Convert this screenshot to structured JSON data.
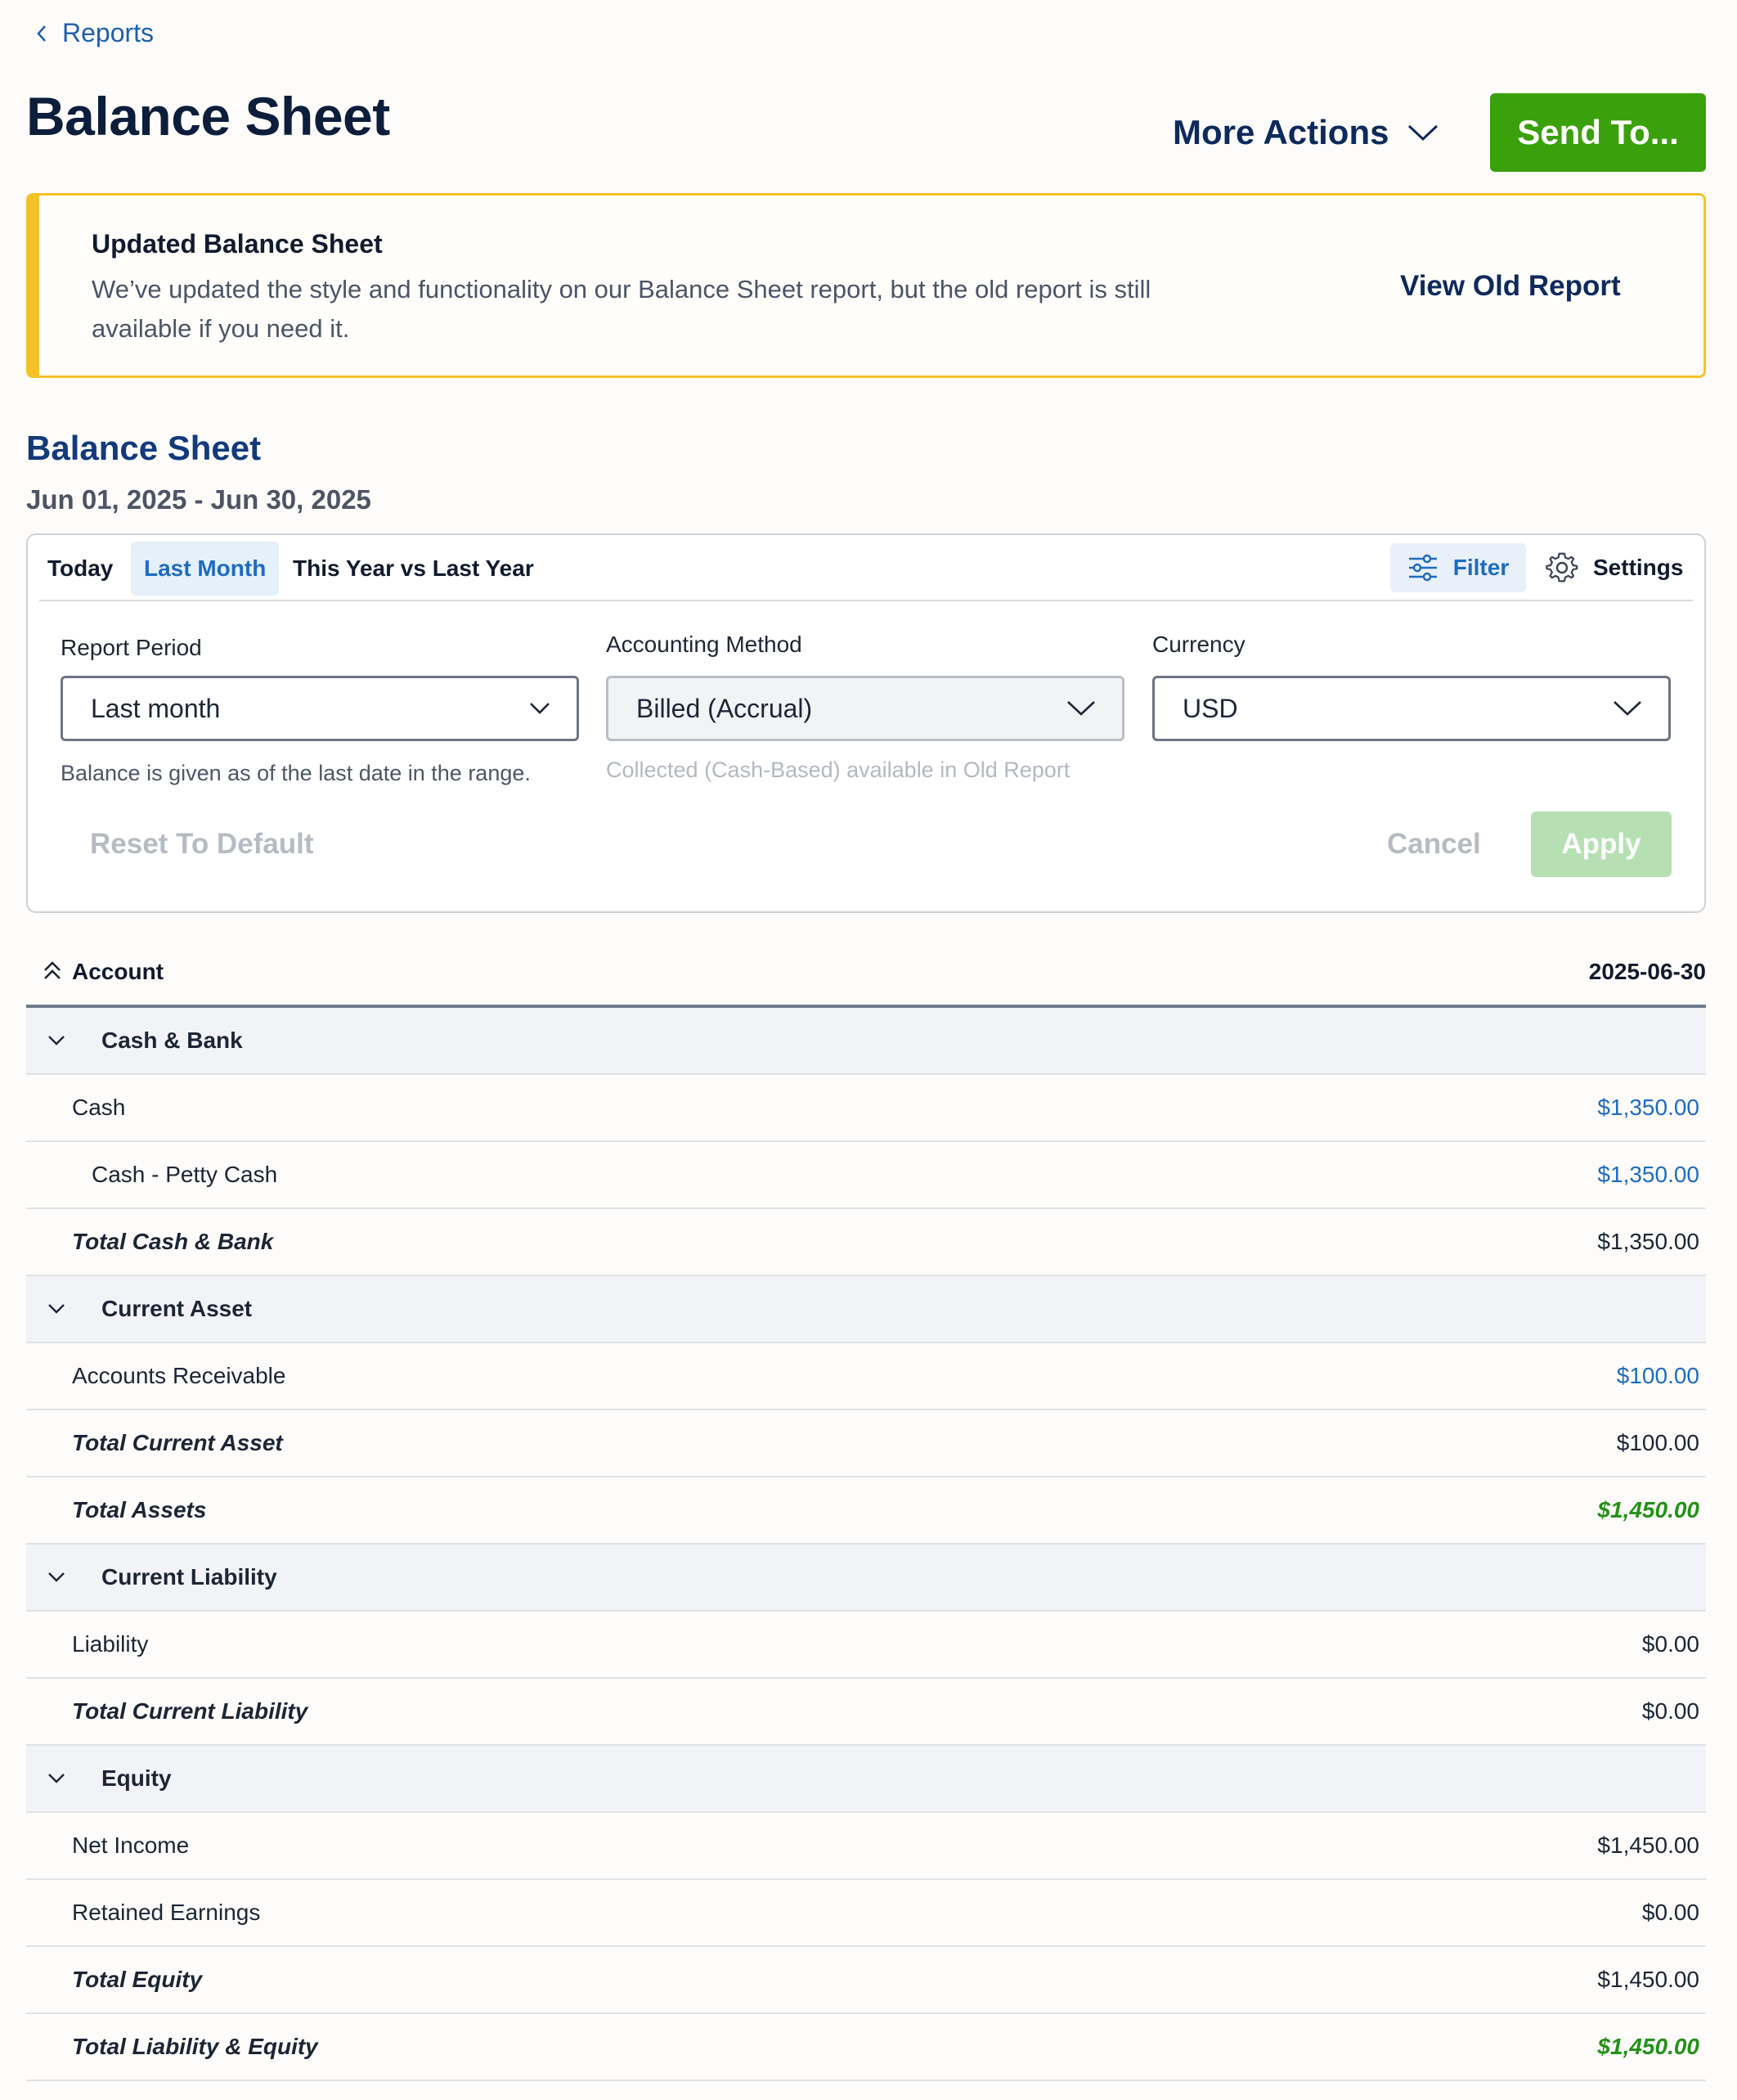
{
  "nav": {
    "back_label": "Reports"
  },
  "header": {
    "title": "Balance Sheet",
    "more_actions_label": "More Actions",
    "send_label": "Send To..."
  },
  "notice": {
    "title": "Updated Balance Sheet",
    "body": "We’ve updated the style and functionality on our Balance Sheet report, but the old report is still available if you need it.",
    "link_label": "View Old Report",
    "accent_color": "#f5c228"
  },
  "report": {
    "title": "Balance Sheet",
    "date_range": "Jun 01, 2025 - Jun 30, 2025"
  },
  "filters": {
    "tabs": [
      "Today",
      "Last Month",
      "This Year vs Last Year"
    ],
    "active_tab": "Last Month",
    "filter_label": "Filter",
    "settings_label": "Settings",
    "report_period": {
      "label": "Report Period",
      "value": "Last month",
      "hint": "Balance is given as of the last date in the range."
    },
    "accounting_method": {
      "label": "Accounting Method",
      "value": "Billed (Accrual)",
      "hint": "Collected (Cash-Based) available in Old Report"
    },
    "currency": {
      "label": "Currency",
      "value": "USD"
    },
    "reset_label": "Reset To Default",
    "cancel_label": "Cancel",
    "apply_label": "Apply"
  },
  "table": {
    "col_account": "Account",
    "col_date": "2025-06-30",
    "rows": [
      {
        "type": "group",
        "label": "Cash & Bank",
        "amount": ""
      },
      {
        "type": "item",
        "label": "Cash",
        "amount": "$1,350.00"
      },
      {
        "type": "subitem",
        "label": "Cash - Petty Cash",
        "amount": "$1,350.00"
      },
      {
        "type": "total",
        "label": "Total Cash & Bank",
        "amount": "$1,350.00"
      },
      {
        "type": "group",
        "label": "Current Asset",
        "amount": ""
      },
      {
        "type": "item",
        "label": "Accounts Receivable",
        "amount": "$100.00"
      },
      {
        "type": "total",
        "label": "Total Current Asset",
        "amount": "$100.00"
      },
      {
        "type": "grandtotal",
        "label": "Total Assets",
        "amount": "$1,450.00"
      },
      {
        "type": "group",
        "label": "Current Liability",
        "amount": ""
      },
      {
        "type": "plain",
        "label": "Liability",
        "amount": "$0.00"
      },
      {
        "type": "total",
        "label": "Total Current Liability",
        "amount": "$0.00"
      },
      {
        "type": "group",
        "label": "Equity",
        "amount": ""
      },
      {
        "type": "plain",
        "label": "Net Income",
        "amount": "$1,450.00"
      },
      {
        "type": "plain",
        "label": "Retained Earnings",
        "amount": "$0.00"
      },
      {
        "type": "total",
        "label": "Total Equity",
        "amount": "$1,450.00"
      },
      {
        "type": "grandtotal",
        "label": "Total Liability & Equity",
        "amount": "$1,450.00"
      }
    ]
  },
  "colors": {
    "brand_green": "#3aa10c",
    "link_blue": "#1f6bc0",
    "total_green": "#249118",
    "navy": "#0d2a5c"
  }
}
